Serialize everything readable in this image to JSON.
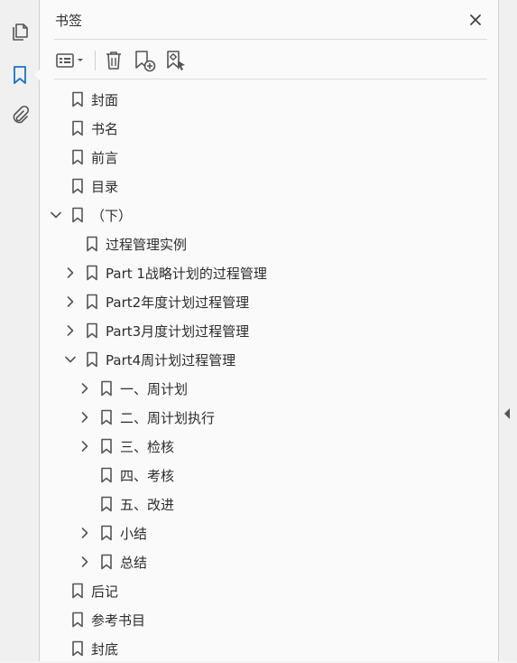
{
  "panel": {
    "title": "书签",
    "close_icon": "close-icon"
  },
  "left_rail": {
    "items": [
      {
        "icon": "pages-icon"
      },
      {
        "icon": "bookmark-icon",
        "active": true
      },
      {
        "icon": "attachment-icon"
      }
    ]
  },
  "toolbar": {
    "items": [
      {
        "icon": "options-menu-icon"
      },
      {
        "icon": "delete-icon"
      },
      {
        "icon": "new-bookmark-icon"
      },
      {
        "icon": "new-bookmark-from-structure-icon"
      }
    ]
  },
  "bookmarks": [
    {
      "label": "封面",
      "level": 0,
      "expand": "none"
    },
    {
      "label": "书名",
      "level": 0,
      "expand": "none"
    },
    {
      "label": "前言",
      "level": 0,
      "expand": "none"
    },
    {
      "label": "目录",
      "level": 0,
      "expand": "none"
    },
    {
      "label": "（下）",
      "level": 0,
      "expand": "expanded"
    },
    {
      "label": "过程管理实例",
      "level": 1,
      "expand": "none"
    },
    {
      "label": "Part 1战略计划的过程管理",
      "level": 1,
      "expand": "collapsed"
    },
    {
      "label": "Part2年度计划过程管理",
      "level": 1,
      "expand": "collapsed"
    },
    {
      "label": "Part3月度计划过程管理",
      "level": 1,
      "expand": "collapsed"
    },
    {
      "label": "Part4周计划过程管理",
      "level": 1,
      "expand": "expanded"
    },
    {
      "label": "一、周计划",
      "level": 2,
      "expand": "collapsed"
    },
    {
      "label": "二、周计划执行",
      "level": 2,
      "expand": "collapsed"
    },
    {
      "label": "三、检核",
      "level": 2,
      "expand": "collapsed"
    },
    {
      "label": "四、考核",
      "level": 2,
      "expand": "none"
    },
    {
      "label": "五、改进",
      "level": 2,
      "expand": "none"
    },
    {
      "label": "小结",
      "level": 2,
      "expand": "collapsed"
    },
    {
      "label": "总结",
      "level": 2,
      "expand": "collapsed"
    },
    {
      "label": "后记",
      "level": 0,
      "expand": "none"
    },
    {
      "label": "参考书目",
      "level": 0,
      "expand": "none"
    },
    {
      "label": "封底",
      "level": 0,
      "expand": "none"
    }
  ],
  "colors": {
    "accent": "#1a73c8",
    "icon": "#555555",
    "text": "#2d2d2d"
  }
}
